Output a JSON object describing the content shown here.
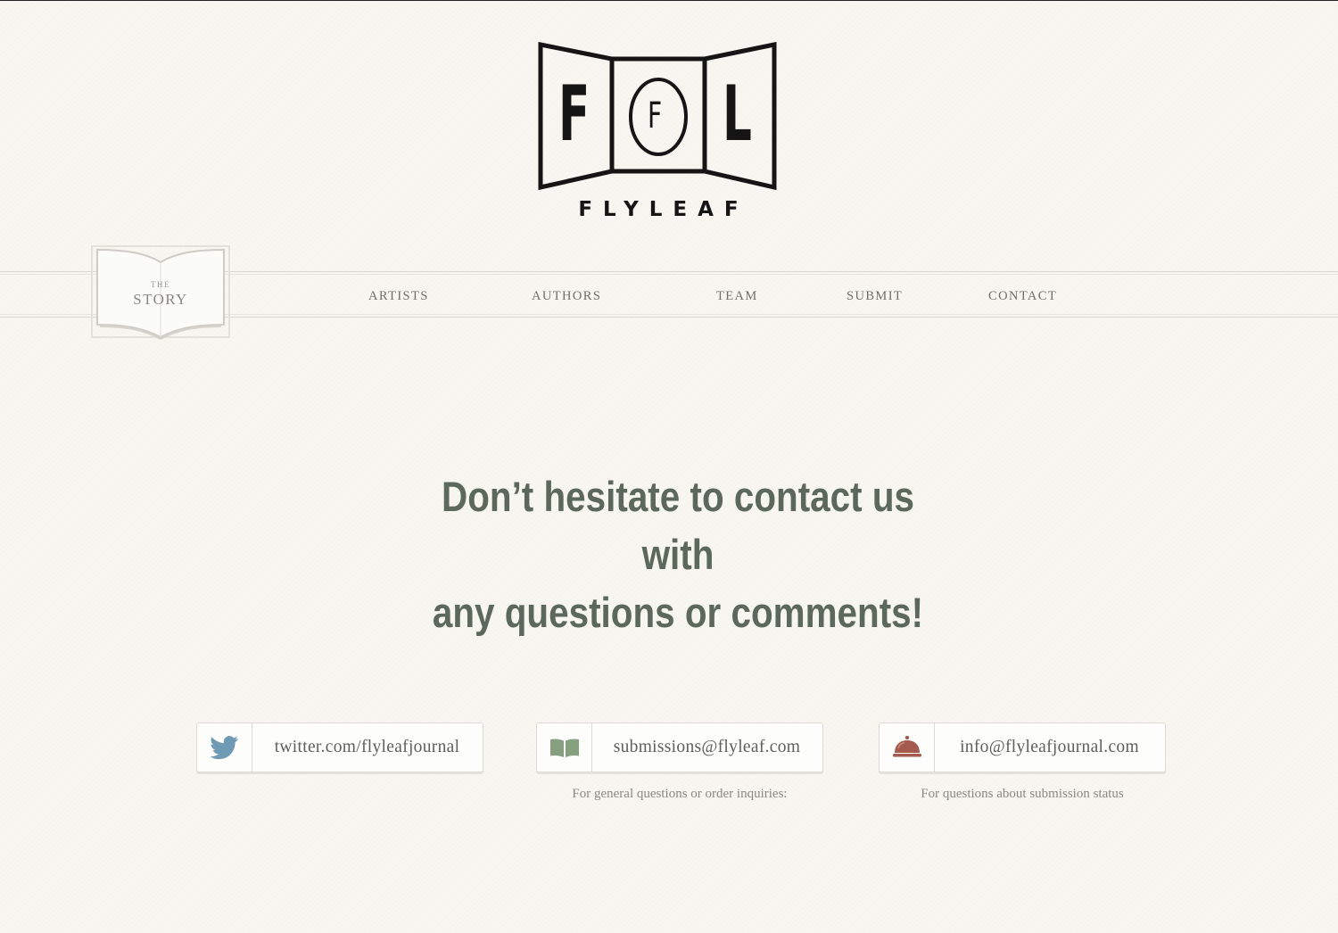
{
  "logo": {
    "letters": [
      "F",
      "F",
      "L"
    ],
    "wordmark": "FLYLEAF"
  },
  "story_badge": {
    "small": "THE",
    "title": "STORY"
  },
  "nav": {
    "items": [
      {
        "label": "ARTISTS"
      },
      {
        "label": "AUTHORS"
      },
      {
        "label": "TEAM"
      },
      {
        "label": "SUBMIT"
      },
      {
        "label": "CONTACT"
      }
    ]
  },
  "headline": {
    "line1": "Don’t hesitate to contact us with",
    "line2": "any questions or comments!"
  },
  "contacts": [
    {
      "icon": "twitter-bird-icon",
      "text": "twitter.com/flyleafjournal",
      "note": "",
      "icon_color": "#6f9ab4"
    },
    {
      "icon": "open-book-icon",
      "text": "submissions@flyleaf.com",
      "note": "For general questions or order inquiries:",
      "icon_color": "#86a07f"
    },
    {
      "icon": "service-bell-icon",
      "text": "info@flyleafjournal.com",
      "note": "For questions about submission status",
      "icon_color": "#a55a4f"
    }
  ],
  "colors": {
    "background": "#f8f6f1",
    "headline": "#5d685d",
    "nav_text": "#6f6f6a",
    "logo_ink": "#151515"
  }
}
